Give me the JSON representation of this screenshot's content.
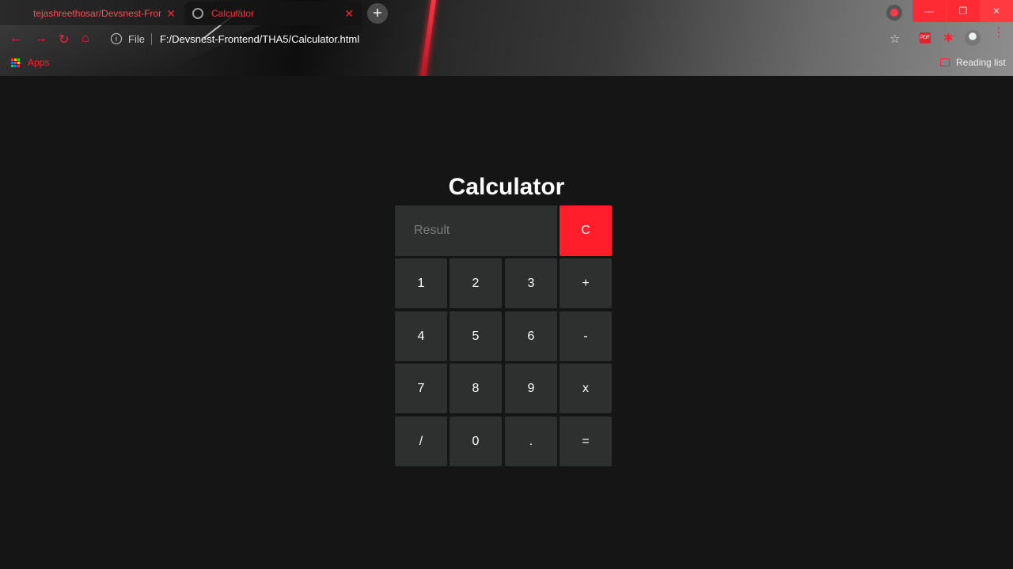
{
  "browser": {
    "tabs": [
      {
        "title": "tejashreethosar/Devsnest-Fronte",
        "close": "✕"
      },
      {
        "title": "Calculator",
        "close": "✕"
      }
    ],
    "new_tab": "+",
    "address": {
      "scheme": "File",
      "url": "F:/Devsnest-Frontend/THA5/Calculator.html"
    },
    "bookmarks": {
      "apps": "Apps",
      "reading_list": "Reading list"
    },
    "window_controls": {
      "minimize": "—",
      "maximize": "❐",
      "close": "✕"
    }
  },
  "page": {
    "title": "Calculator",
    "result_placeholder": "Result",
    "clear_label": "C",
    "keys": [
      [
        "1",
        "2",
        "3",
        "+"
      ],
      [
        "4",
        "5",
        "6",
        "-"
      ],
      [
        "7",
        "8",
        "9",
        "x"
      ],
      [
        "/",
        "0",
        ".",
        "="
      ]
    ]
  },
  "colors": {
    "accent": "#ff1e2a",
    "key_bg": "#2e2f2f",
    "page_bg": "#151515"
  }
}
